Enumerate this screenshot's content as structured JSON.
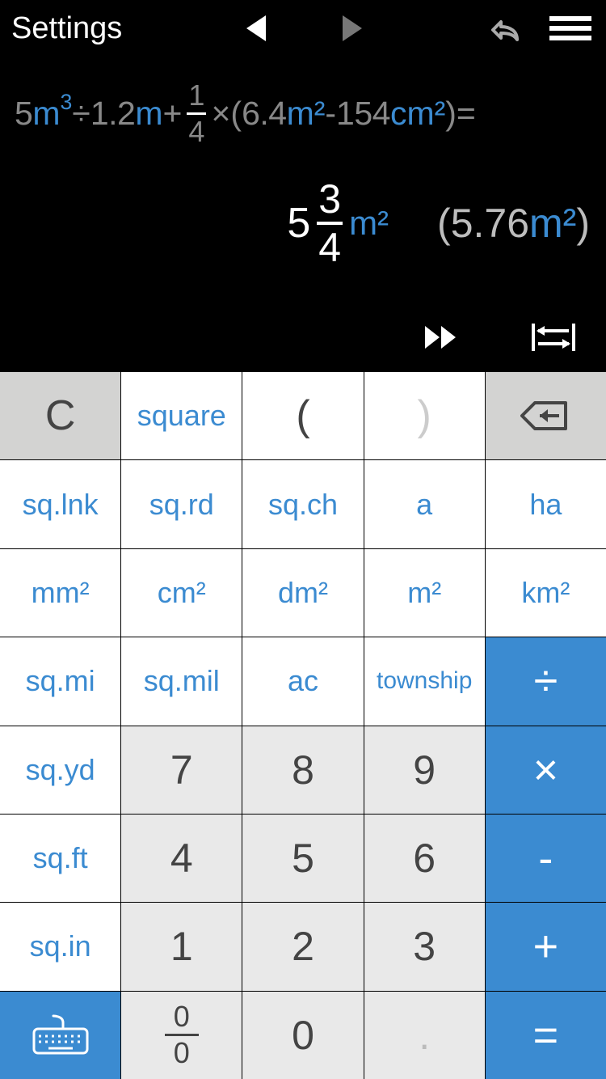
{
  "header": {
    "settings_label": "Settings"
  },
  "expression": {
    "p1_val": "5",
    "p1_unit": "m",
    "p1_sup": "3",
    "div": " ÷ ",
    "p2_val": "1.2",
    "p2_unit": "m",
    "plus": " + ",
    "frac_num": "1",
    "frac_den": "4",
    "times": " × ",
    "open": "(",
    "p3_val": "6.4",
    "p3_unit": "m²",
    "minus": " - ",
    "p4_val": "154",
    "p4_unit": "cm²",
    "close": ")",
    "eq": " ="
  },
  "answer": {
    "mixed_whole": "5",
    "mixed_num": "3",
    "mixed_den": "4",
    "mixed_unit": "m²",
    "dec_open": "(",
    "dec_val": "5.76",
    "dec_unit": "m²",
    "dec_close": ")"
  },
  "keys": {
    "clear": "C",
    "square": "square",
    "lparen": "(",
    "rparen": ")",
    "sq_lnk": "sq.lnk",
    "sq_rd": "sq.rd",
    "sq_ch": "sq.ch",
    "are": "a",
    "ha": "ha",
    "mm2": "mm²",
    "cm2": "cm²",
    "dm2": "dm²",
    "m2": "m²",
    "km2": "km²",
    "sq_mi": "sq.mi",
    "sq_mil": "sq.mil",
    "ac": "ac",
    "township": "township",
    "sq_yd": "sq.yd",
    "sq_ft": "sq.ft",
    "sq_in": "sq.in",
    "n7": "7",
    "n8": "8",
    "n9": "9",
    "n4": "4",
    "n5": "5",
    "n6": "6",
    "n1": "1",
    "n2": "2",
    "n3": "3",
    "n0": "0",
    "div": "÷",
    "mul": "×",
    "sub": "-",
    "add": "+",
    "eq": "=",
    "frac_n": "0",
    "frac_d": "0",
    "dot": "."
  }
}
